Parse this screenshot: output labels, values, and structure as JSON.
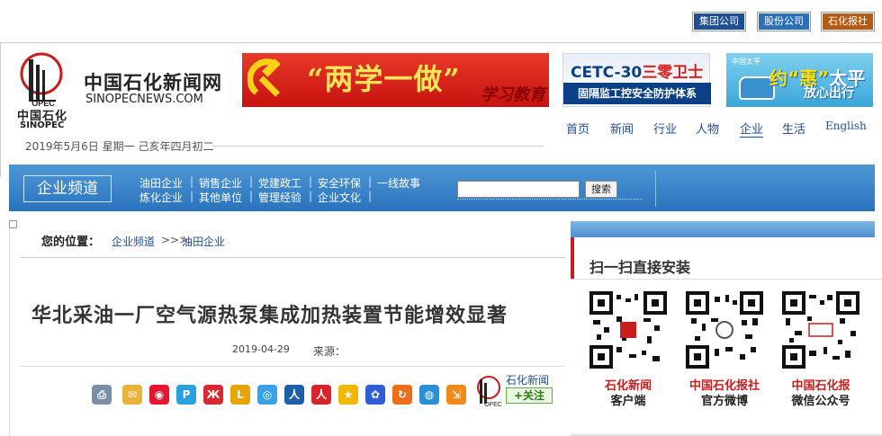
{
  "top_links": [
    "集团公司",
    "股份公司",
    "石化报社"
  ],
  "logo": {
    "cn": "中国石化",
    "en": "SINOPEC",
    "mark": "sinopec-logo"
  },
  "site": {
    "name_cn": "中国石化新闻网",
    "name_en": "SINOPECNEWS.COM"
  },
  "date_line": "2019年5月6日 星期一 己亥年四月初二",
  "banners": {
    "b1_title": "“两学一做”",
    "b1_sub": "学习教育",
    "b2_line1a": "CETC-30",
    "b2_line1b": "三零卫士",
    "b2_line2": "固隔监工控安全防护体系",
    "b3_small": "中国太平",
    "b3_main_a": "约",
    "b3_main_b": "“惠”",
    "b3_main_c": "太平",
    "b3_sub": "放心出行"
  },
  "main_nav": [
    "首页",
    "新闻",
    "行业",
    "人物",
    "企业",
    "生活",
    "English"
  ],
  "channel": {
    "title": "企业频道",
    "row1": [
      "油田企业",
      "销售企业",
      "党建政工",
      "安全环保",
      "一线故事"
    ],
    "row2": [
      "炼化企业",
      "其他单位",
      "管理经验",
      "企业文化"
    ],
    "search_button": "搜索",
    "search_value": ""
  },
  "breadcrumb": {
    "label": "您的位置：",
    "items": [
      "企业频道",
      "油田企业"
    ],
    "arrow": ">>>"
  },
  "article": {
    "title": "华北采油一厂空气源热泵集成加热装置节能增效显著",
    "date": "2019-04-29",
    "source_label": "来源："
  },
  "share_icons": [
    "print-icon",
    "email-icon",
    "weibo-icon",
    "qzone-icon",
    "renren-icon",
    "tieba-icon",
    "tqq-icon",
    "renmin-icon",
    "people-icon",
    "favorite-icon",
    "baidu-icon",
    "share-icon",
    "world-icon",
    "tsina-icon"
  ],
  "follow": {
    "name": "石化新闻",
    "button": "+关注"
  },
  "right_panel": {
    "title": "扫一扫直接安装",
    "qrs": [
      {
        "l1": "石化新闻",
        "l2": "客户端"
      },
      {
        "l1": "中国石化报社",
        "l2": "官方微博"
      },
      {
        "l1": "中国石化报",
        "l2": "微信公众号"
      }
    ]
  },
  "colors": {
    "accent_blue": "#2a73bd",
    "brand_red": "#c81e1e",
    "link_blue": "#1f4f92"
  }
}
